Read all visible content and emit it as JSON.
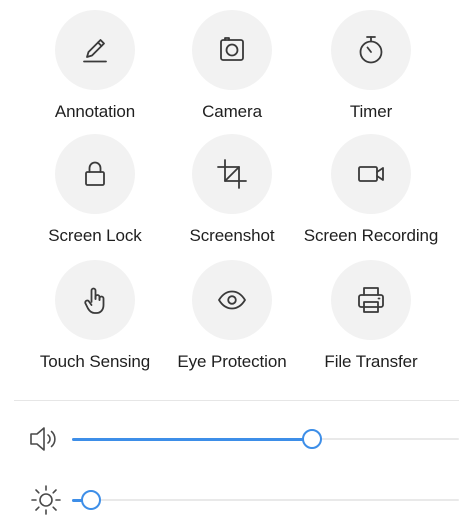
{
  "quick_actions": [
    {
      "label": "Annotation",
      "icon": "pencil-icon"
    },
    {
      "label": "Camera",
      "icon": "camera-icon"
    },
    {
      "label": "Timer",
      "icon": "stopwatch-icon"
    },
    {
      "label": "Screen Lock",
      "icon": "lock-icon"
    },
    {
      "label": "Screenshot",
      "icon": "crop-icon"
    },
    {
      "label": "Screen Recording",
      "icon": "video-camera-icon"
    },
    {
      "label": "Touch Sensing",
      "icon": "touch-hand-icon"
    },
    {
      "label": "Eye Protection",
      "icon": "eye-icon"
    },
    {
      "label": "File Transfer",
      "icon": "printer-icon"
    }
  ],
  "sliders": {
    "volume": {
      "icon": "speaker-icon",
      "level_percent": 62
    },
    "brightness": {
      "icon": "sun-icon",
      "level_percent": 5
    }
  },
  "colors": {
    "accent": "#3d8ee8",
    "tile_background": "#f2f2f2",
    "icon_stroke": "#3a3a3a",
    "track": "#e9e9e9"
  }
}
